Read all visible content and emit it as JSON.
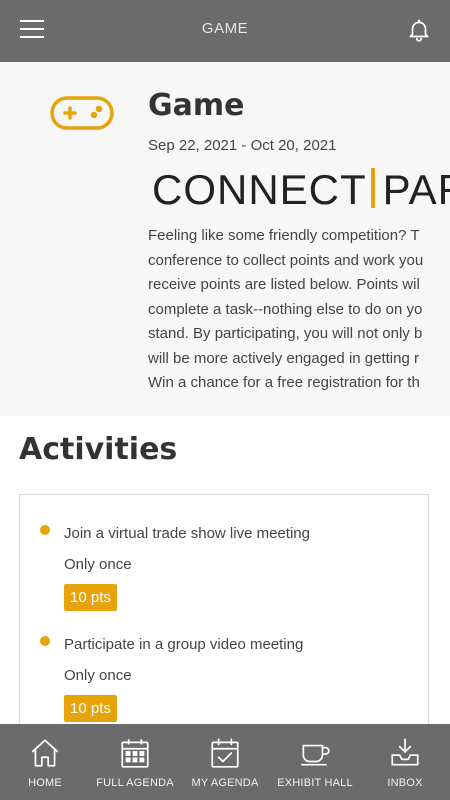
{
  "header": {
    "title": "GAME"
  },
  "game": {
    "title": "Game",
    "dates": "Sep 22, 2021 - Oct 20, 2021",
    "banner_left": "CONNECT",
    "banner_right": "PAR",
    "description_lines": [
      "Feeling like some friendly competition? T",
      "conference to collect points and work you",
      "receive points are listed below.  Points wil",
      "complete a task--nothing else to do on yo",
      "stand. By participating, you will not only b",
      "will be more actively engaged in getting r",
      "Win a chance for a free registration for th"
    ]
  },
  "activities": {
    "heading": "Activities",
    "items": [
      {
        "name": "Join a virtual trade show live meeting",
        "frequency": "Only once",
        "points": "10 pts"
      },
      {
        "name": "Participate in a group video meeting",
        "frequency": "Only once",
        "points": "10 pts"
      }
    ]
  },
  "nav": {
    "items": [
      {
        "label": "HOME",
        "icon": "home-icon"
      },
      {
        "label": "FULL AGENDA",
        "icon": "calendar-icon"
      },
      {
        "label": "MY AGENDA",
        "icon": "calendar-check-icon"
      },
      {
        "label": "EXHIBIT HALL",
        "icon": "coffee-cup-icon"
      },
      {
        "label": "INBOX",
        "icon": "inbox-download-icon"
      }
    ]
  },
  "colors": {
    "header_bg": "#6b6b6b",
    "accent": "#e6a30b",
    "section_bg": "#f7f7f7"
  }
}
